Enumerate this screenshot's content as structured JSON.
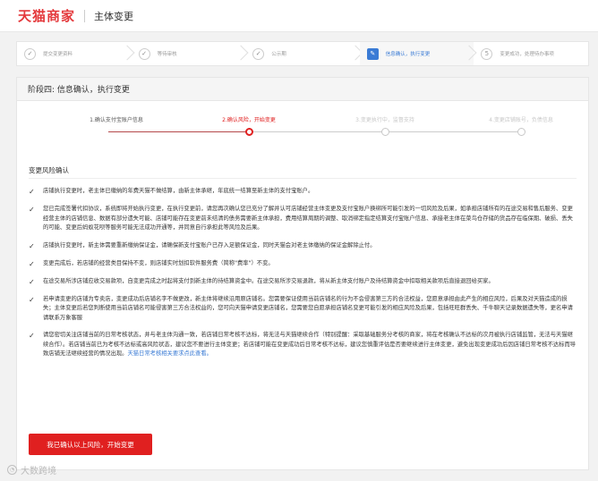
{
  "header": {
    "brand": "天猫商家",
    "page_name": "主体变更"
  },
  "steps": [
    {
      "label": "提交变更资料",
      "state": "done",
      "icon": "check-icon"
    },
    {
      "label": "等待审核",
      "state": "done",
      "icon": "check-icon"
    },
    {
      "label": "公示期",
      "state": "done",
      "icon": "check-icon"
    },
    {
      "label": "信息确认，执行变更",
      "state": "active",
      "icon": "edit-icon"
    },
    {
      "label": "变更成功，处理待办事项",
      "state": "todo",
      "icon": "5"
    }
  ],
  "card": {
    "title": "阶段四: 信息确认，执行变更"
  },
  "progress": {
    "items": [
      {
        "label": "1.确认支付宝账户信息",
        "state": "done"
      },
      {
        "label": "2.确认风险，开始变更",
        "state": "active"
      },
      {
        "label": "3.变更执行中，监督支持",
        "state": "todo"
      },
      {
        "label": "4.变更店铺账号，负债信息",
        "state": "todo"
      }
    ]
  },
  "section": {
    "title": "变更风险确认"
  },
  "risks": [
    {
      "text": "店铺执行变更时，老主体已缴纳的年费天猫不做结算，由新主体承继，年底统一结算至新主体的支付宝账户。"
    },
    {
      "text": "您已完成签署代扣协议，系统即将开始执行变更，在执行变更前，请您再次确认您已充分了解并认可店铺经营主体变更及支付宝账户换绑所可能引发的一切风险及后果，如承担店铺所有的在途交易和售后服务、变更经营主体的店铺信息、数据有部分遗失可能、店铺可能存在变更前未结清的债务需要新主体承担，费用结算周期的调整、取消绑定指定结算支付宝账户信息、承接老主体在菜鸟仓存储的货品存在临保期、破损、丢失的可能、变更后蚂蚁花呗等服务可能无法成功开通等，并同意自行承担此等风险及后果。"
    },
    {
      "text": "店铺执行变更时，新主体需要重新缴纳保证金，请确保新支付宝账户已存入足额保证金，同时天猫会对老主体缴纳的保证金解除止付。"
    },
    {
      "text": "变更完成后，若店铺的经营类目保持不变，则店铺实时划扣软件服务费（简称\"费率\"）不变。"
    },
    {
      "text": "在途交易所涉店铺应收交易款项，自变更完成之时起将支付到新主体的待结算资金中。在途交易所涉交易退款，将从新主体支付账户及待结算资金中扣取相关款项后直接退回给买家。"
    },
    {
      "text": "若申请变更的店铺为专卖店，变更成功后店铺名字不做更改，新主体将继续沿用原店铺名。您需要保证使用当前店铺名的行为不会侵害第三方的合法权益，您愿意承担由此产生的相应风险，后果及对天猫造成的损失；主体变更后若您判断使用当前店铺名可能侵害第三方合法权益的，您可向天猫申请变更店铺名，您需要您自愿承担店铺名变更可能引发的相应风险及后果，包括旺旺群丢失、千牛聊天记录数据遗失等，更名申请请联系万象客服"
    },
    {
      "text": "请您密切关注店铺当前的日常考核状态，并与老主体沟通一致，若店铺日常考核不达标，将无法与天猫继续合作（特别提醒：采取基础服务分考核的商家，将在考核确认不达标的次月被执行店铺监管，无法与天猫继续合作）。若店铺当前已为考核不达标或高风险状态，建议您不要进行主体变更；若店铺可能在变更成功后日常考核不达标，建议您慎重评估是否要继续进行主体变更，避免出现变更成功后因店铺日常考核不达标而导致店铺无法继续经营的情况出现。",
      "link": "天猫日常考核相关要求点此查看。"
    }
  ],
  "confirm_button": "我已确认以上风险，开始变更",
  "watermark": "大数跨境",
  "colors": {
    "brand_red": "#e4393c",
    "active_blue": "#3a7bd5",
    "progress_done": "#b5484a",
    "progress_active": "#e02020",
    "progress_todo": "#cccccc"
  }
}
